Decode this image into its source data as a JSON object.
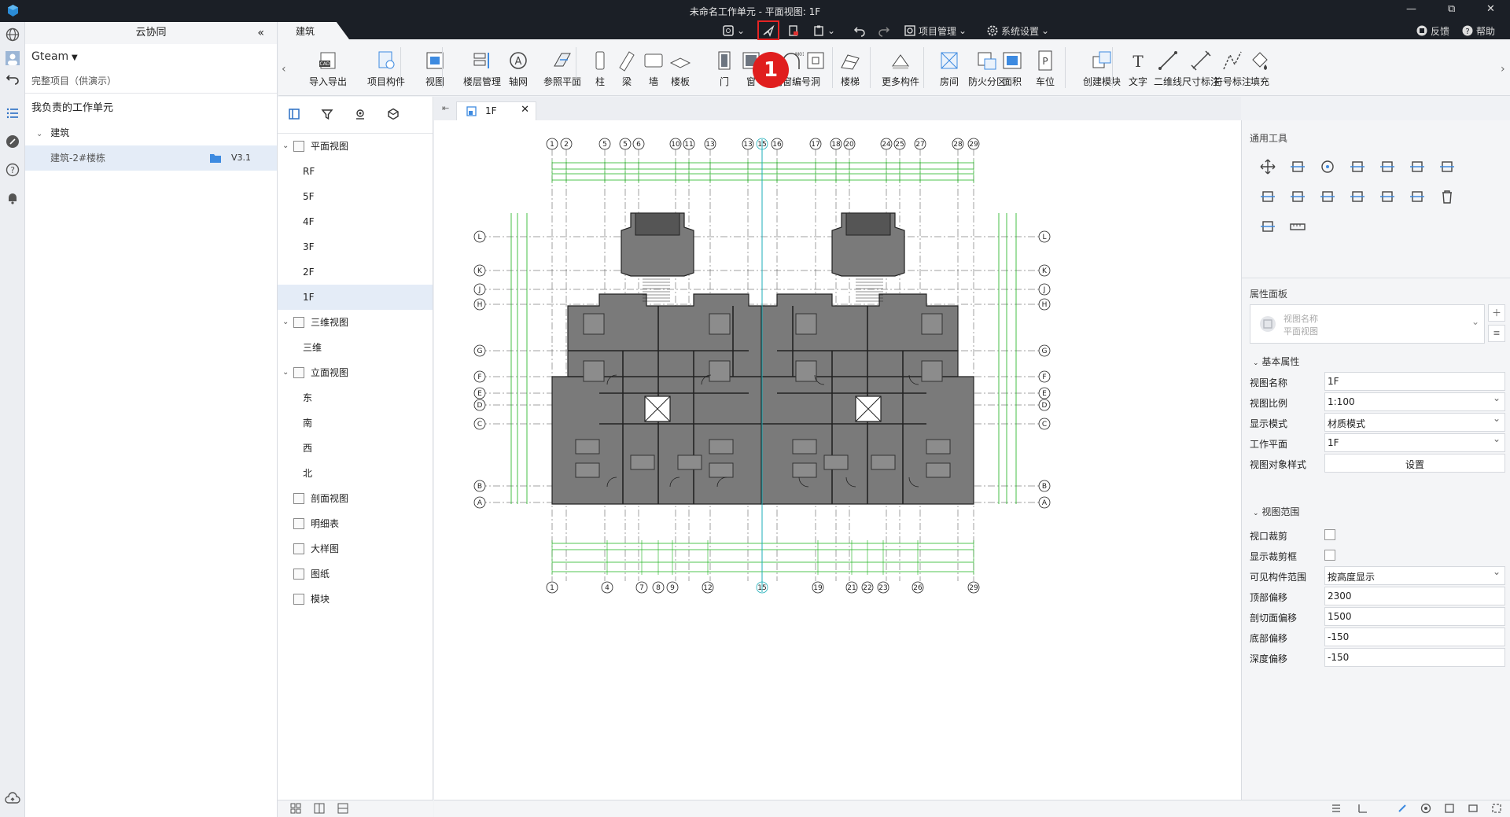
{
  "titlebar": {
    "title": "未命名工作单元 - 平面视图: 1F",
    "restore": "⧉",
    "close": "✕"
  },
  "quick": {
    "project_manage": "项目管理",
    "system_settings": "系统设置",
    "feedback": "反馈",
    "help": "帮助"
  },
  "tabs": {
    "active": "建筑"
  },
  "ribbon": [
    {
      "label": "导入导出",
      "icon": "cad-import-icon"
    },
    {
      "label": "项目构件",
      "icon": "project-component-icon"
    },
    {
      "label": "视图",
      "icon": "view-icon"
    },
    {
      "label": "楼层管理",
      "icon": "floor-manage-icon"
    },
    {
      "label": "轴网",
      "icon": "grid-icon"
    },
    {
      "label": "参照平面",
      "icon": "ref-plane-icon"
    },
    {
      "label": "柱",
      "icon": "column-icon"
    },
    {
      "label": "梁",
      "icon": "beam-icon"
    },
    {
      "label": "墙",
      "icon": "wall-icon"
    },
    {
      "label": "楼板",
      "icon": "slab-icon"
    },
    {
      "label": "门",
      "icon": "door-icon"
    },
    {
      "label": "窗",
      "icon": "window-icon"
    },
    {
      "label": "门窗编号",
      "icon": "door-window-tag-icon"
    },
    {
      "label": "洞",
      "icon": "opening-icon"
    },
    {
      "label": "楼梯",
      "icon": "stair-icon"
    },
    {
      "label": "更多构件",
      "icon": "more-components-icon"
    },
    {
      "label": "房间",
      "icon": "room-icon"
    },
    {
      "label": "防火分区",
      "icon": "fire-zone-icon"
    },
    {
      "label": "面积",
      "icon": "area-icon"
    },
    {
      "label": "车位",
      "icon": "parking-icon"
    },
    {
      "label": "创建模块",
      "icon": "create-module-icon"
    },
    {
      "label": "文字",
      "icon": "text-icon"
    },
    {
      "label": "二维线",
      "icon": "line-2d-icon"
    },
    {
      "label": "尺寸标注",
      "icon": "dimension-icon"
    },
    {
      "label": "符号标注",
      "icon": "symbol-icon"
    },
    {
      "label": "填充",
      "icon": "fill-icon"
    }
  ],
  "annotation": {
    "number": "1"
  },
  "leftpanel": {
    "title": "云协同",
    "team": "Gteam",
    "project": "完整项目（供演示）",
    "section": "我负责的工作单元",
    "group": "建筑",
    "unit": "建筑-2#楼栋",
    "version": "V3.1"
  },
  "views": {
    "plan": "平面视图",
    "plan_items": [
      "RF",
      "5F",
      "4F",
      "3F",
      "2F",
      "1F"
    ],
    "three_d": "三维视图",
    "three_d_items": [
      "三维"
    ],
    "elev": "立面视图",
    "elev_items": [
      "东",
      "南",
      "西",
      "北"
    ],
    "section": "剖面视图",
    "schedule": "明细表",
    "detail": "大样图",
    "sheet": "图纸",
    "module": "模块"
  },
  "doc_tab": {
    "label": "1F"
  },
  "drawing": {
    "top_axes": [
      "1",
      "2",
      "5",
      "5",
      "6",
      "10",
      "11",
      "13",
      "13",
      "15",
      "16",
      "17",
      "18",
      "20",
      "24",
      "25",
      "27",
      "28",
      "29"
    ],
    "bottom_axes": [
      "1",
      "4",
      "7",
      "8",
      "9",
      "12",
      "15",
      "19",
      "21",
      "22",
      "23",
      "26",
      "29"
    ],
    "side_axes": [
      "L",
      "K",
      "J",
      "H",
      "G",
      "F",
      "E",
      "D",
      "C",
      "B",
      "A"
    ]
  },
  "rightpanel": {
    "tools_title": "通用工具",
    "props_title": "属性面板",
    "view_name_label": "视图名称",
    "view_name_sub": "平面视图",
    "basic_props": "基本属性",
    "rows": [
      {
        "label": "视图名称",
        "value": "1F",
        "type": "text"
      },
      {
        "label": "视图比例",
        "value": "1:100",
        "type": "dd"
      },
      {
        "label": "显示模式",
        "value": "材质模式",
        "type": "dd"
      },
      {
        "label": "工作平面",
        "value": "1F",
        "type": "dd"
      },
      {
        "label": "视图对象样式",
        "value": "设置",
        "type": "btn"
      }
    ],
    "range_title": "视图范围",
    "range_rows": [
      {
        "label": "视口裁剪",
        "type": "chk"
      },
      {
        "label": "显示裁剪框",
        "type": "chk"
      },
      {
        "label": "可见构件范围",
        "value": "按高度显示",
        "type": "dd"
      },
      {
        "label": "顶部偏移",
        "value": "2300",
        "type": "text"
      },
      {
        "label": "剖切面偏移",
        "value": "1500",
        "type": "text"
      },
      {
        "label": "底部偏移",
        "value": "-150",
        "type": "text"
      },
      {
        "label": "深度偏移",
        "value": "-150",
        "type": "text"
      }
    ]
  }
}
